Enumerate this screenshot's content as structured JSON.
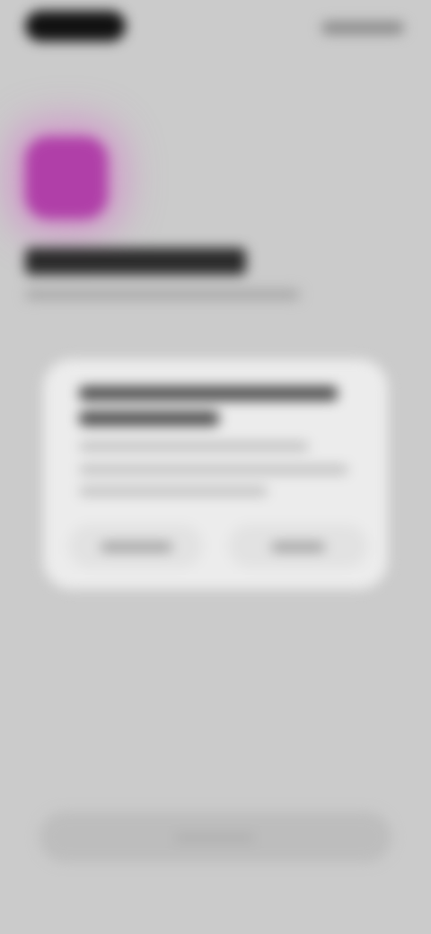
{
  "status_bar": {
    "time": "",
    "icons": [
      "signal-icon",
      "wifi-icon",
      "battery-icon"
    ]
  },
  "app": {
    "icon_name": "app-icon",
    "accent_color": "#b03fa8",
    "title": "",
    "subtitle": ""
  },
  "dialog": {
    "title": "",
    "body": "",
    "secondary_button_label": "",
    "primary_button_label": ""
  },
  "bottom_button": {
    "label": ""
  },
  "colors": {
    "background": "#cbcbcb",
    "dialog_background": "#ececec",
    "accent": "#b03fa8"
  }
}
